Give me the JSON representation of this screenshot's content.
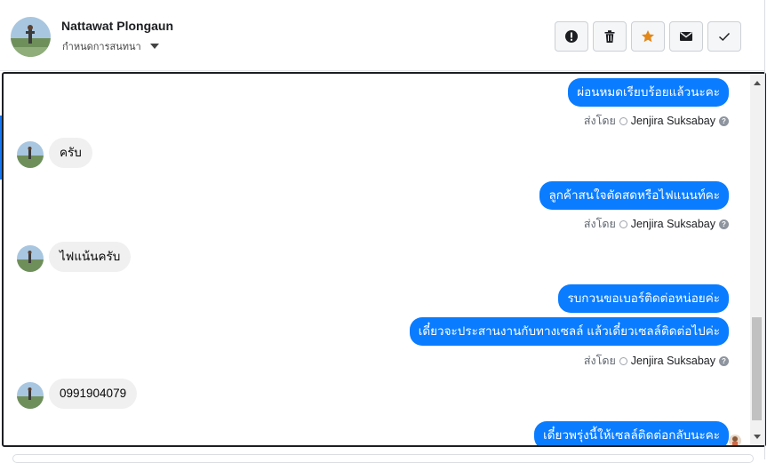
{
  "header": {
    "contact_name": "Nattawat Plongaun",
    "status_label": "กำหนดการสนทนา",
    "actions": [
      {
        "name": "report-button",
        "icon": "exclamation-icon"
      },
      {
        "name": "delete-button",
        "icon": "trash-icon"
      },
      {
        "name": "star-button",
        "icon": "star-icon"
      },
      {
        "name": "mark-unread-button",
        "icon": "envelope-icon"
      },
      {
        "name": "mark-done-button",
        "icon": "check-icon"
      }
    ]
  },
  "colors": {
    "accent": "#0a7cff",
    "star": "#e2881b",
    "incoming_bubble": "#f0f0f0"
  },
  "messages": {
    "m1": "ผ่อนหมดเรียบร้อยแล้วนะคะ",
    "m2": "ครับ",
    "m3": "ลูกค้าสนใจตัดสดหรือไฟแนนท์คะ",
    "m4": "ไฟแน้นครับ",
    "m5": "รบกวนขอเบอร์ติดต่อหน่อยค่ะ",
    "m6": "เดี๋ยวจะประสานงานกับทางเซลล์ แล้วเดี๋ยวเซลล์ติดต่อไปค่ะ",
    "m7": "0991904079",
    "m8": "เดี๋ยวพรุ่งนี้ให้เซลล์ติดต่อกลับนะคะ"
  },
  "sent_by": {
    "prefix": "ส่งโดย",
    "agent": "Jenjira Suksabay"
  }
}
